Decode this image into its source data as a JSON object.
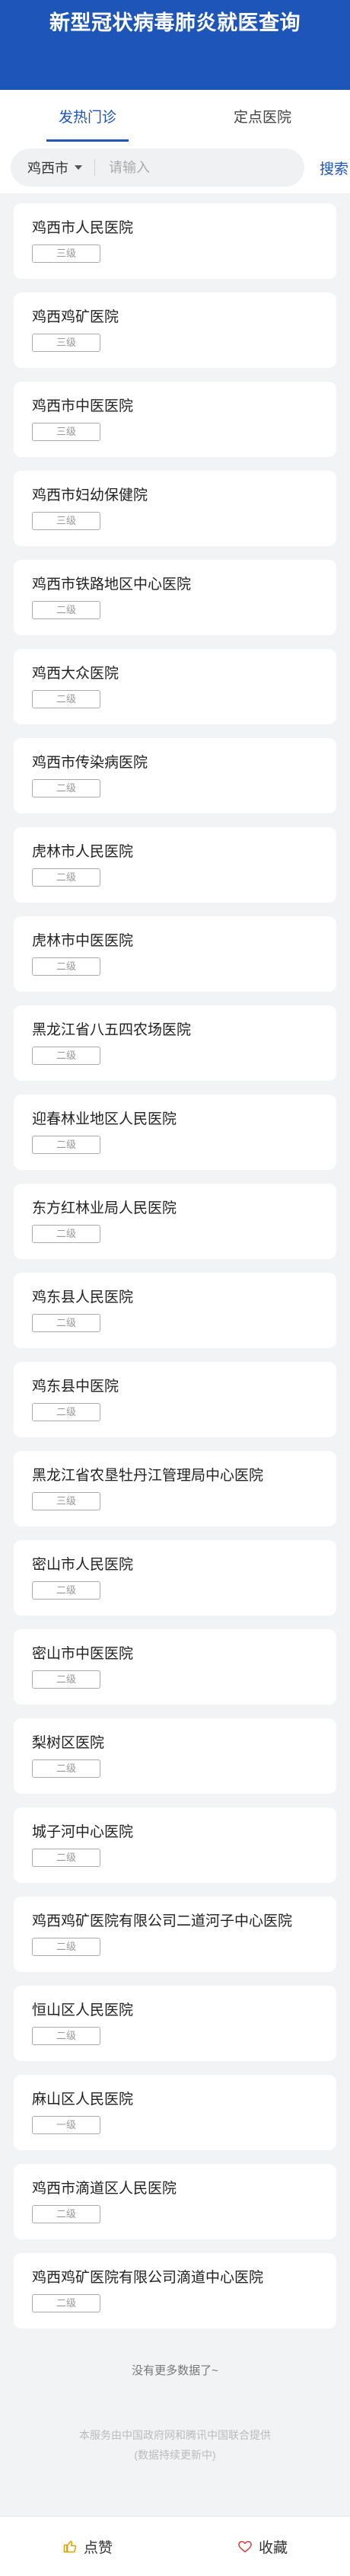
{
  "header": {
    "title": "新型冠状病毒肺炎就医查询"
  },
  "tabs": [
    {
      "label": "发热门诊",
      "active": true
    },
    {
      "label": "定点医院",
      "active": false
    }
  ],
  "search": {
    "city": "鸡西市",
    "placeholder": "请输入",
    "button_label": "搜索"
  },
  "hospitals": [
    {
      "name": "鸡西市人民医院",
      "level": "三级"
    },
    {
      "name": "鸡西鸡矿医院",
      "level": "三级"
    },
    {
      "name": "鸡西市中医医院",
      "level": "三级"
    },
    {
      "name": "鸡西市妇幼保健院",
      "level": "三级"
    },
    {
      "name": "鸡西市铁路地区中心医院",
      "level": "二级"
    },
    {
      "name": "鸡西大众医院",
      "level": "二级"
    },
    {
      "name": "鸡西市传染病医院",
      "level": "二级"
    },
    {
      "name": "虎林市人民医院",
      "level": "二级"
    },
    {
      "name": "虎林市中医医院",
      "level": "二级"
    },
    {
      "name": "黑龙江省八五四农场医院",
      "level": "二级"
    },
    {
      "name": "迎春林业地区人民医院",
      "level": "二级"
    },
    {
      "name": "东方红林业局人民医院",
      "level": "二级"
    },
    {
      "name": "鸡东县人民医院",
      "level": "二级"
    },
    {
      "name": "鸡东县中医院",
      "level": "二级"
    },
    {
      "name": "黑龙江省农垦牡丹江管理局中心医院",
      "level": "三级"
    },
    {
      "name": "密山市人民医院",
      "level": "二级"
    },
    {
      "name": "密山市中医医院",
      "level": "二级"
    },
    {
      "name": "梨树区医院",
      "level": "二级"
    },
    {
      "name": "城子河中心医院",
      "level": "二级"
    },
    {
      "name": "鸡西鸡矿医院有限公司二道河子中心医院",
      "level": "二级"
    },
    {
      "name": "恒山区人民医院",
      "level": "二级"
    },
    {
      "name": "麻山区人民医院",
      "level": "一级"
    },
    {
      "name": "鸡西市滴道区人民医院",
      "level": "二级"
    },
    {
      "name": "鸡西鸡矿医院有限公司滴道中心医院",
      "level": "二级"
    }
  ],
  "footer": {
    "no_more": "没有更多数据了~",
    "notice_line1": "本服务由中国政府网和腾讯中国联合提供",
    "notice_line2": "(数据持续更新中)"
  },
  "bottom_bar": {
    "like_label": "点赞",
    "like_icon": "thumbs-up-icon",
    "favorite_label": "收藏",
    "favorite_icon": "heart-icon"
  },
  "colors": {
    "brand": "#1d56b8",
    "background": "#f2f3f5"
  }
}
